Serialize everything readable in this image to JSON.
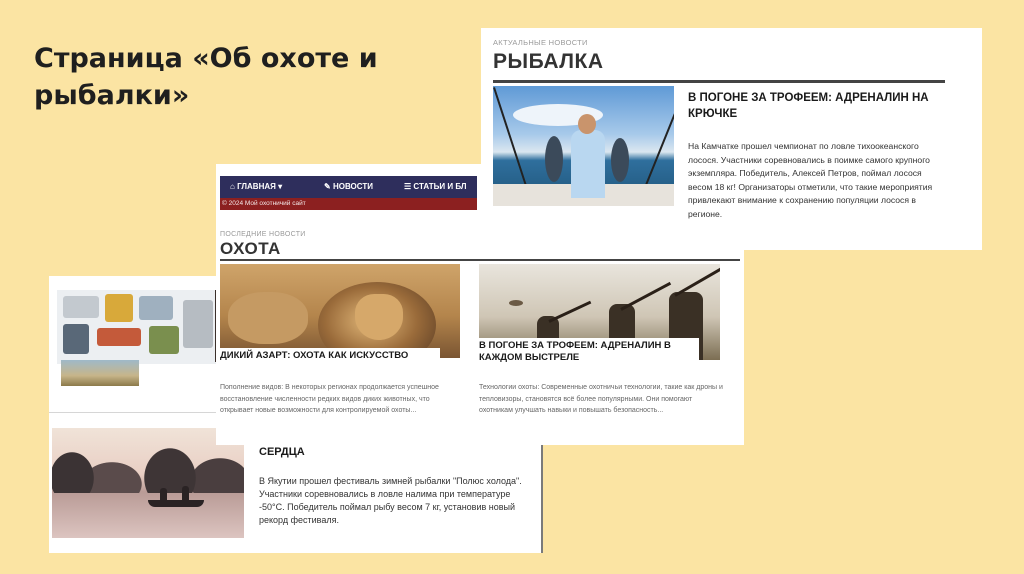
{
  "slide": {
    "title": "Страница «Об охоте и рыбалки»"
  },
  "fishing_site": {
    "kicker": "АКТУАЛЬНЫЕ НОВОСТИ",
    "heading": "РЫБАЛКА",
    "article": {
      "title": "В ПОГОНЕ ЗА ТРОФЕЕМ: АДРЕНАЛИН НА КРЮЧКЕ",
      "body": "На Камчатке прошел чемпионат по ловле тихоокеанского лосося. Участники соревновались в поимке самого крупного экземпляра. Победитель, Алексей Петров, поймал лосося весом 18 кг! Организаторы отметили, что такие мероприятия привлекают внимание к сохранению популяции лосося в регионе."
    }
  },
  "hunting_site": {
    "nav": [
      {
        "icon": "home-icon",
        "glyph": "⌂",
        "label": "ГЛАВНАЯ ▾"
      },
      {
        "icon": "edit-icon",
        "glyph": "✎",
        "label": "НОВОСТИ"
      },
      {
        "icon": "list-icon",
        "glyph": "☰",
        "label": "СТАТЬИ И БЛ"
      }
    ],
    "copyright": "© 2024 Мой охотничий сайт",
    "kicker": "ПОСЛЕДНИЕ НОВОСТИ",
    "heading": "ОХОТА",
    "cards": [
      {
        "title": "ДИКИЙ АЗАРТ: ОХОТА КАК ИСКУССТВО",
        "text": "Пополнение видов: В некоторых регионах продолжается успешное восстановление численности редких видов диких животных, что открывает новые возможности для контролируемой охоты..."
      },
      {
        "title": "В ПОГОНЕ ЗА ТРОФЕЕМ: АДРЕНАЛИН В КАЖДОМ ВЫСТРЕЛЕ",
        "text": "Технологии охоты: Современные охотничьи технологии, такие как дроны и тепловизоры, становятся всё более популярными. Они помогают охотникам улучшать навыки и повышать безопасность..."
      }
    ]
  },
  "festival_site": {
    "article": {
      "title": "СЕРДЦА",
      "body": "В Якутии прошел фестиваль зимней рыбалки \"Полюс холода\". Участники соревновались в ловле налима при температуре -50°С. Победитель поймал рыбу весом 7 кг, установив новый рекорд фестиваля."
    }
  }
}
